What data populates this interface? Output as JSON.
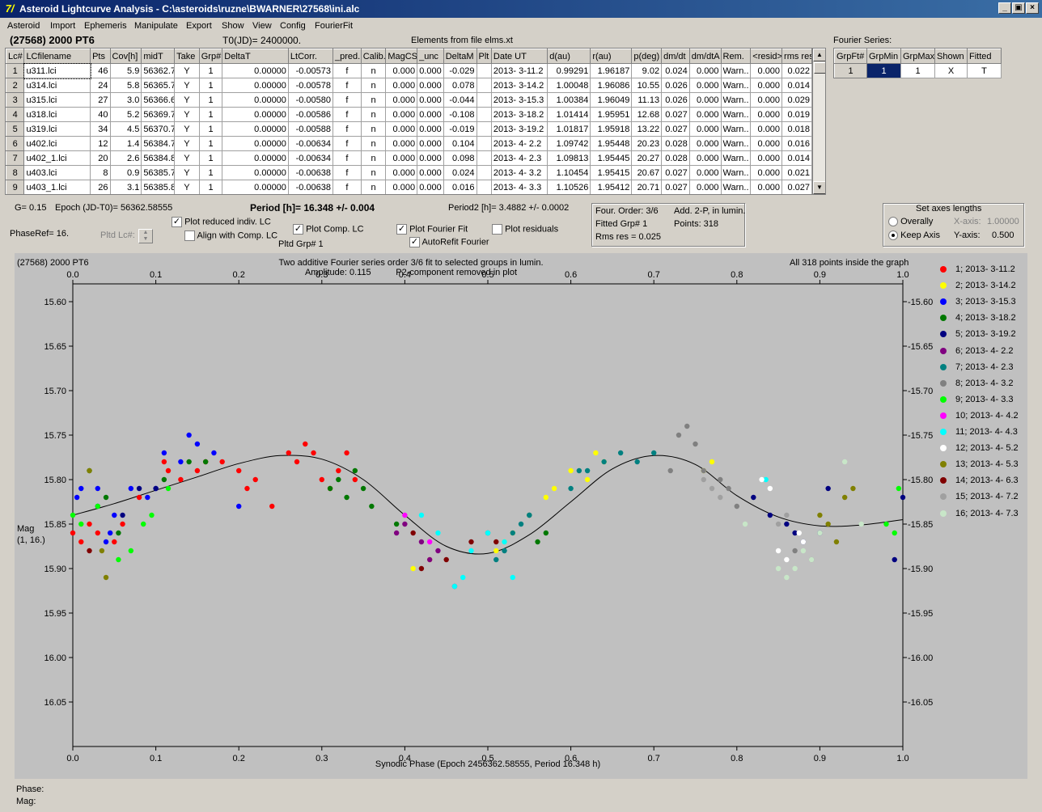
{
  "window": {
    "title": "Asteroid Lightcurve Analysis - C:\\asteroids\\ruzne\\BWARNER\\27568\\ini.alc",
    "app_icon": "7/",
    "buttons": [
      "_",
      "▣",
      "×"
    ]
  },
  "menu": [
    "Asteroid",
    "Import",
    "Ephemeris",
    "Manipulate",
    "Export",
    "Show",
    "View",
    "Config",
    "FourierFit"
  ],
  "header": {
    "asteroid": "(27568) 2000 PT6",
    "t0": "T0(JD)= 2400000.",
    "elements": "Elements from file elms.xt"
  },
  "grid": {
    "columns": [
      "Lc#",
      "LCfilename",
      "Pts",
      "Cov[h]",
      "midT",
      "Take",
      "Grp#",
      "DeltaT",
      "LtCorr.",
      "_pred.",
      "Calib.",
      "MagCS",
      "_unc",
      "DeltaM",
      "Plt",
      "Date UT",
      "d(au)",
      "r(au)",
      "p(deg)",
      "dm/dt",
      "dm/dtA",
      "Rem.",
      "<resid>",
      "rms res"
    ],
    "rows": [
      [
        "1",
        "u311.lci",
        "46",
        "5.9",
        "56362.7",
        "Y",
        "1",
        "0.00000",
        "-0.00573",
        "f",
        "n",
        "0.000",
        "0.000",
        "-0.029",
        "",
        "2013- 3-11.2",
        "0.99291",
        "1.96187",
        "9.02",
        "0.024",
        "0.000",
        "Warn..",
        "0.000",
        "0.022"
      ],
      [
        "2",
        "u314.lci",
        "24",
        "5.8",
        "56365.7",
        "Y",
        "1",
        "0.00000",
        "-0.00578",
        "f",
        "n",
        "0.000",
        "0.000",
        "0.078",
        "",
        "2013- 3-14.2",
        "1.00048",
        "1.96086",
        "10.55",
        "0.026",
        "0.000",
        "Warn..",
        "0.000",
        "0.014"
      ],
      [
        "3",
        "u315.lci",
        "27",
        "3.0",
        "56366.6",
        "Y",
        "1",
        "0.00000",
        "-0.00580",
        "f",
        "n",
        "0.000",
        "0.000",
        "-0.044",
        "",
        "2013- 3-15.3",
        "1.00384",
        "1.96049",
        "11.13",
        "0.026",
        "0.000",
        "Warn..",
        "0.000",
        "0.029"
      ],
      [
        "4",
        "u318.lci",
        "40",
        "5.2",
        "56369.7",
        "Y",
        "1",
        "0.00000",
        "-0.00586",
        "f",
        "n",
        "0.000",
        "0.000",
        "-0.108",
        "",
        "2013- 3-18.2",
        "1.01414",
        "1.95951",
        "12.68",
        "0.027",
        "0.000",
        "Warn..",
        "0.000",
        "0.019"
      ],
      [
        "5",
        "u319.lci",
        "34",
        "4.5",
        "56370.7",
        "Y",
        "1",
        "0.00000",
        "-0.00588",
        "f",
        "n",
        "0.000",
        "0.000",
        "-0.019",
        "",
        "2013- 3-19.2",
        "1.01817",
        "1.95918",
        "13.22",
        "0.027",
        "0.000",
        "Warn..",
        "0.000",
        "0.018"
      ],
      [
        "6",
        "u402.lci",
        "12",
        "1.4",
        "56384.7",
        "Y",
        "1",
        "0.00000",
        "-0.00634",
        "f",
        "n",
        "0.000",
        "0.000",
        "0.104",
        "",
        "2013- 4- 2.2",
        "1.09742",
        "1.95448",
        "20.23",
        "0.028",
        "0.000",
        "Warn..",
        "0.000",
        "0.016"
      ],
      [
        "7",
        "u402_1.lci",
        "20",
        "2.6",
        "56384.8",
        "Y",
        "1",
        "0.00000",
        "-0.00634",
        "f",
        "n",
        "0.000",
        "0.000",
        "0.098",
        "",
        "2013- 4- 2.3",
        "1.09813",
        "1.95445",
        "20.27",
        "0.028",
        "0.000",
        "Warn..",
        "0.000",
        "0.014"
      ],
      [
        "8",
        "u403.lci",
        "8",
        "0.9",
        "56385.7",
        "Y",
        "1",
        "0.00000",
        "-0.00638",
        "f",
        "n",
        "0.000",
        "0.000",
        "0.024",
        "",
        "2013- 4- 3.2",
        "1.10454",
        "1.95415",
        "20.67",
        "0.027",
        "0.000",
        "Warn..",
        "0.000",
        "0.021"
      ],
      [
        "9",
        "u403_1.lci",
        "26",
        "3.1",
        "56385.8",
        "Y",
        "1",
        "0.00000",
        "-0.00638",
        "f",
        "n",
        "0.000",
        "0.000",
        "0.016",
        "",
        "2013- 4- 3.3",
        "1.10526",
        "1.95412",
        "20.71",
        "0.027",
        "0.000",
        "Warn..",
        "0.000",
        "0.027"
      ]
    ]
  },
  "fourier_series": {
    "title": "Fourier Series:",
    "columns": [
      "GrpFt#",
      "GrpMin",
      "GrpMax",
      "Shown",
      "Fitted"
    ],
    "row": [
      "1",
      "1",
      "1",
      "X",
      "T"
    ]
  },
  "info": {
    "g": "G= 0.15",
    "epoch": "Epoch (JD-T0)= 56362.58555",
    "period": "Period [h]= 16.348 +/- 0.004",
    "period2": "Period2 [h]= 3.4882 +/- 0.0002",
    "phaseref": "PhaseRef= 16.",
    "pltd_lc": "Pltd Lc#:",
    "pltd_grp": "Pltd Grp#  1",
    "cb_reduced": "Plot reduced indiv. LC",
    "cb_align": "Align with Comp. LC",
    "cb_comp": "Plot Comp. LC",
    "cb_fourier": "Plot Fourier Fit",
    "cb_residuals": "Plot residuals",
    "cb_autorefit": "AutoRefit Fourier",
    "four_order": "Four. Order:  3/6",
    "add2p": "Add. 2-P, in lumin.",
    "fitted_grp": "Fitted Grp# 1",
    "points": "Points: 318",
    "rms": "Rms res     = 0.025"
  },
  "axes_box": {
    "title": "Set axes lengths",
    "overally": "Overally",
    "keep": "Keep Axis",
    "xaxis_label": "X-axis:",
    "xaxis_value": "1.00000",
    "yaxis_label": "Y-axis:",
    "yaxis_value": "0.500"
  },
  "status": {
    "phase": "Phase:",
    "mag": "Mag:"
  },
  "chart_data": {
    "type": "scatter",
    "corner_label": "(27568) 2000 PT6",
    "title": "Two additive Fourier series order 3/6 fit to selected groups in lumin.",
    "subtitle": "Amplitude: 0.115          P2-component removed in plot",
    "right_note": "All 318 points inside the graph",
    "xlabel": "Synodic Phase (Epoch 2456362.58555, Period 16.348 h)",
    "ylabel": "Mag",
    "ylabel2": "(1, 16.)",
    "xlim": [
      0,
      1
    ],
    "ylim": [
      16.1,
      15.58
    ],
    "y_inverted": true,
    "xticks": [
      0.0,
      0.1,
      0.2,
      0.3,
      0.4,
      0.5,
      0.6,
      0.7,
      0.8,
      0.9,
      1.0
    ],
    "yticks": [
      15.6,
      15.65,
      15.7,
      15.75,
      15.8,
      15.85,
      15.9,
      15.95,
      16.0,
      16.05
    ],
    "grid": false,
    "legend_position": "right",
    "fit_curve": {
      "x": [
        0.0,
        0.05,
        0.1,
        0.15,
        0.2,
        0.25,
        0.3,
        0.35,
        0.4,
        0.45,
        0.5,
        0.55,
        0.6,
        0.65,
        0.7,
        0.75,
        0.8,
        0.85,
        0.9,
        0.95,
        1.0
      ],
      "y": [
        15.84,
        15.827,
        15.812,
        15.797,
        15.782,
        15.773,
        15.777,
        15.8,
        15.84,
        15.875,
        15.883,
        15.862,
        15.825,
        15.788,
        15.773,
        15.783,
        15.818,
        15.842,
        15.852,
        15.851,
        15.845
      ]
    },
    "series": [
      {
        "name": "1; 2013- 3-11.2",
        "color": "#ff0000",
        "x": [
          0.0,
          0.01,
          0.02,
          0.03,
          0.05,
          0.06,
          0.08,
          0.11,
          0.115,
          0.13,
          0.15,
          0.16,
          0.18,
          0.2,
          0.21,
          0.22,
          0.24,
          0.26,
          0.27,
          0.28,
          0.29,
          0.3,
          0.31,
          0.32,
          0.33,
          0.34
        ],
        "y": [
          15.86,
          15.87,
          15.85,
          15.86,
          15.87,
          15.85,
          15.82,
          15.78,
          15.79,
          15.8,
          15.79,
          15.78,
          15.78,
          15.79,
          15.81,
          15.8,
          15.83,
          15.77,
          15.78,
          15.76,
          15.77,
          15.8,
          15.81,
          15.79,
          15.77,
          15.8
        ]
      },
      {
        "name": "2; 2013- 3-14.2",
        "color": "#ffff00",
        "x": [
          0.41,
          0.43,
          0.51,
          0.52,
          0.53,
          0.57,
          0.58,
          0.6,
          0.62,
          0.63,
          0.64,
          0.76,
          0.77
        ],
        "y": [
          15.9,
          15.89,
          15.88,
          15.87,
          15.86,
          15.82,
          15.81,
          15.79,
          15.8,
          15.77,
          15.78,
          15.79,
          15.78
        ]
      },
      {
        "name": "3; 2013- 3-15.3",
        "color": "#0000ff",
        "x": [
          0.005,
          0.01,
          0.03,
          0.04,
          0.045,
          0.05,
          0.07,
          0.09,
          0.1,
          0.11,
          0.13,
          0.14,
          0.15,
          0.17,
          0.2
        ],
        "y": [
          15.82,
          15.81,
          15.81,
          15.87,
          15.86,
          15.84,
          15.81,
          15.82,
          15.81,
          15.77,
          15.78,
          15.75,
          15.76,
          15.77,
          15.83
        ]
      },
      {
        "name": "4; 2013- 3-18.2",
        "color": "#007800",
        "x": [
          0.02,
          0.04,
          0.055,
          0.11,
          0.14,
          0.16,
          0.31,
          0.32,
          0.33,
          0.34,
          0.35,
          0.36,
          0.39,
          0.55,
          0.56,
          0.57
        ],
        "y": [
          15.79,
          15.82,
          15.86,
          15.8,
          15.78,
          15.78,
          15.81,
          15.8,
          15.82,
          15.79,
          15.81,
          15.83,
          15.85,
          15.84,
          15.87,
          15.86
        ]
      },
      {
        "name": "5; 2013- 3-19.2",
        "color": "#000080",
        "x": [
          0.03,
          0.06,
          0.08,
          0.1,
          0.82,
          0.84,
          0.86,
          0.87,
          0.88,
          0.9,
          0.91,
          0.99,
          1.0
        ],
        "y": [
          15.83,
          15.84,
          15.81,
          15.81,
          15.82,
          15.84,
          15.85,
          15.86,
          15.87,
          15.86,
          15.81,
          15.89,
          15.82
        ]
      },
      {
        "name": "6; 2013- 4- 2.2",
        "color": "#800080",
        "x": [
          0.39,
          0.4,
          0.42,
          0.43,
          0.44,
          0.46
        ],
        "y": [
          15.86,
          15.85,
          15.87,
          15.89,
          15.88,
          15.92
        ]
      },
      {
        "name": "7; 2013- 4- 2.3",
        "color": "#008080",
        "x": [
          0.5,
          0.51,
          0.52,
          0.53,
          0.54,
          0.55,
          0.6,
          0.61,
          0.62,
          0.64,
          0.66,
          0.68,
          0.7
        ],
        "y": [
          15.86,
          15.89,
          15.88,
          15.86,
          15.85,
          15.84,
          15.81,
          15.79,
          15.79,
          15.78,
          15.77,
          15.78,
          15.77
        ]
      },
      {
        "name": "8; 2013- 4- 3.2",
        "color": "#808080",
        "x": [
          0.72,
          0.73,
          0.74,
          0.75,
          0.76,
          0.78,
          0.79,
          0.8,
          0.87,
          0.89
        ],
        "y": [
          15.79,
          15.75,
          15.74,
          15.76,
          15.79,
          15.8,
          15.81,
          15.83,
          15.88,
          15.89
        ]
      },
      {
        "name": "9; 2013- 4- 3.3",
        "color": "#00ff00",
        "x": [
          0.0,
          0.01,
          0.03,
          0.055,
          0.07,
          0.085,
          0.095,
          0.115,
          0.98,
          0.99,
          0.995
        ],
        "y": [
          15.84,
          15.85,
          15.83,
          15.89,
          15.88,
          15.85,
          15.84,
          15.81,
          15.85,
          15.86,
          15.81
        ]
      },
      {
        "name": "10; 2013- 4- 4.2",
        "color": "#ff00ff",
        "x": [
          0.4,
          0.43
        ],
        "y": [
          15.84,
          15.87
        ]
      },
      {
        "name": "11; 2013- 4- 4.3",
        "color": "#00ffff",
        "x": [
          0.42,
          0.44,
          0.46,
          0.47,
          0.48,
          0.5,
          0.52,
          0.53,
          0.835
        ],
        "y": [
          15.84,
          15.86,
          15.92,
          15.91,
          15.88,
          15.86,
          15.87,
          15.91,
          15.8
        ]
      },
      {
        "name": "12; 2013- 4- 5.2",
        "color": "#ffffff",
        "x": [
          0.83,
          0.84,
          0.85,
          0.86,
          0.875,
          0.88
        ],
        "y": [
          15.8,
          15.81,
          15.88,
          15.89,
          15.86,
          15.87
        ]
      },
      {
        "name": "13; 2013- 4- 5.3",
        "color": "#808000",
        "x": [
          0.02,
          0.035,
          0.04,
          0.9,
          0.91,
          0.92,
          0.93,
          0.94
        ],
        "y": [
          15.79,
          15.88,
          15.91,
          15.84,
          15.85,
          15.87,
          15.82,
          15.81
        ]
      },
      {
        "name": "14; 2013- 4- 6.3",
        "color": "#800000",
        "x": [
          0.02,
          0.41,
          0.42,
          0.45,
          0.48,
          0.51
        ],
        "y": [
          15.88,
          15.86,
          15.9,
          15.89,
          15.87,
          15.87
        ]
      },
      {
        "name": "15; 2013- 4- 7.2",
        "color": "#a0a0a0",
        "x": [
          0.76,
          0.77,
          0.78,
          0.85,
          0.86
        ],
        "y": [
          15.8,
          15.81,
          15.82,
          15.85,
          15.84
        ]
      },
      {
        "name": "16; 2013- 4- 7.3",
        "color": "#c8e6c8",
        "x": [
          0.81,
          0.85,
          0.86,
          0.87,
          0.88,
          0.89,
          0.9,
          0.93,
          0.95
        ],
        "y": [
          15.85,
          15.9,
          15.91,
          15.9,
          15.88,
          15.89,
          15.86,
          15.78,
          15.85
        ]
      }
    ]
  }
}
